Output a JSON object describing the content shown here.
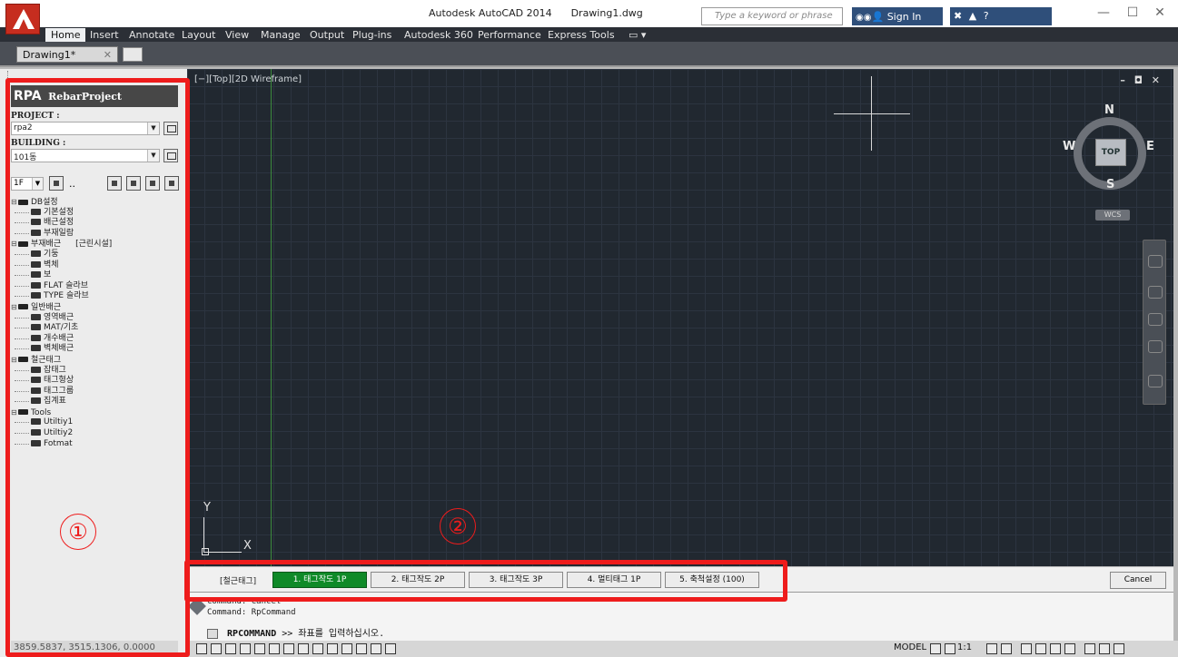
{
  "titlebar": {
    "app_name": "Autodesk AutoCAD 2014",
    "file_name": "Drawing1.dwg",
    "search_placeholder": "Type a keyword or phrase",
    "sign_in": "Sign In",
    "minimize": "—",
    "maximize": "☐",
    "close": "✕"
  },
  "ribbon": {
    "tabs": [
      "Home",
      "Insert",
      "Annotate",
      "Layout",
      "View",
      "Manage",
      "Output",
      "Plug-ins",
      "Autodesk 360",
      "Performance",
      "Express Tools"
    ]
  },
  "document": {
    "tab_label": "Drawing1*",
    "close_glyph": "✕"
  },
  "panel": {
    "brand": "RPA",
    "brand_sub": "RebarProject",
    "project_label": "PROJECT :",
    "project_value": "rpa2",
    "building_label": "BUILDING :",
    "building_value": "101동",
    "floor_value": "1F",
    "dots": "..",
    "tree": [
      {
        "label": "DB설정",
        "level": 1
      },
      {
        "label": "기본설정",
        "level": 2
      },
      {
        "label": "배근설정",
        "level": 2
      },
      {
        "label": "부재일람",
        "level": 2
      },
      {
        "label": "부재배근",
        "level": 1,
        "aside": "[근린시설]"
      },
      {
        "label": "기둥",
        "level": 2
      },
      {
        "label": "벽체",
        "level": 2
      },
      {
        "label": "보",
        "level": 2
      },
      {
        "label": "FLAT 슬라브",
        "level": 2
      },
      {
        "label": "TYPE 슬라브",
        "level": 2
      },
      {
        "label": "일반배근",
        "level": 1
      },
      {
        "label": "영역배근",
        "level": 2
      },
      {
        "label": "MAT/기초",
        "level": 2
      },
      {
        "label": "개수배근",
        "level": 2
      },
      {
        "label": "벽체배근",
        "level": 2
      },
      {
        "label": "철근태그",
        "level": 1
      },
      {
        "label": "잡태그",
        "level": 2
      },
      {
        "label": "태그형상",
        "level": 2
      },
      {
        "label": "태그그룹",
        "level": 2
      },
      {
        "label": "집계표",
        "level": 2
      },
      {
        "label": "Tools",
        "level": 1
      },
      {
        "label": "Utiltiy1",
        "level": 2
      },
      {
        "label": "Utiltiy2",
        "level": 2
      },
      {
        "label": "Fotmat",
        "level": 2
      }
    ],
    "coords": "3859.5837, 3515.1306, 0.0000"
  },
  "annotations": {
    "circle_1": "①",
    "circle_2": "②"
  },
  "canvas": {
    "view_label": "[−][Top][2D Wireframe]",
    "controls": "– ◘ ✕",
    "viewcube": {
      "north": "N",
      "south": "S",
      "east": "E",
      "west": "W",
      "face": "TOP",
      "wcs": "WCS"
    },
    "ucs_x": "X",
    "ucs_y": "Y"
  },
  "tagbar": {
    "title": "[철근태그]",
    "buttons": [
      "1. 태그작도 1P",
      "2. 태그작도 2P",
      "3. 태그작도 3P",
      "4. 멀티태그 1P",
      "5. 축척설정 (100)"
    ],
    "active_index": 0,
    "cancel": "Cancel"
  },
  "command": {
    "history": [
      "Command: Cancel",
      "Command: RpCommand"
    ],
    "prompt_cmd": "RPCOMMAND",
    "prompt_text": ">> 좌표를 입력하십시오."
  },
  "statusbar": {
    "model": "MODEL",
    "scale": "1:1"
  },
  "colors": {
    "canvas_bg": "#212830",
    "ribbon_bg": "#2b2f36",
    "annotation_red": "#ee1c1c",
    "active_button": "#0f8a28"
  }
}
